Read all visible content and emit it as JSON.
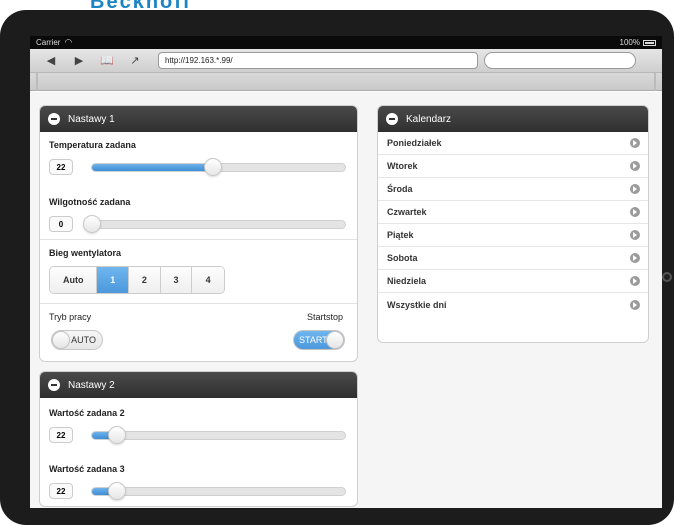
{
  "status_bar": {
    "carrier": "Carrier",
    "battery": "100%"
  },
  "browser": {
    "url": "http://192.163.*.99/"
  },
  "panel1": {
    "title": "Nastawy 1",
    "temp": {
      "label": "Temperatura zadana",
      "value": "22",
      "fraction": 0.48
    },
    "humidity": {
      "label": "Wilgotność zadana",
      "value": "0",
      "fraction": 0.0
    },
    "fan": {
      "label": "Bieg wentylatora",
      "options": [
        "Auto",
        "1",
        "2",
        "3",
        "4"
      ],
      "selected": "1"
    },
    "mode": {
      "label": "Tryb pracy",
      "value": "AUTO"
    },
    "startstop": {
      "label": "Startstop",
      "value": "START"
    }
  },
  "panel2": {
    "title": "Nastawy 2",
    "set2": {
      "label": "Wartość zadana 2",
      "value": "22",
      "fraction": 0.1
    },
    "set3": {
      "label": "Wartość zadana 3",
      "value": "22",
      "fraction": 0.1
    }
  },
  "calendar": {
    "title": "Kalendarz",
    "items": [
      "Poniedziałek",
      "Wtorek",
      "Środa",
      "Czwartek",
      "Piątek",
      "Sobota",
      "Niedziela",
      "Wszystkie dni"
    ]
  }
}
